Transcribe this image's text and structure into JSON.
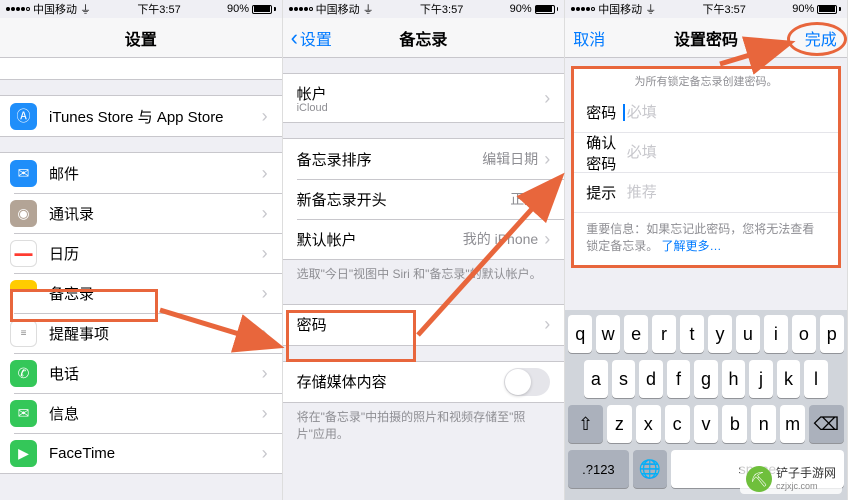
{
  "status": {
    "carrier": "中国移动",
    "time": "下午3:57",
    "battery": "90%"
  },
  "screen1": {
    "title": "设置",
    "itunes": "iTunes Store 与 App Store",
    "items": [
      {
        "label": "邮件",
        "icon_color": "#1f8efa"
      },
      {
        "label": "通讯录",
        "icon_color": "#8e8e93"
      },
      {
        "label": "日历",
        "icon_color": "#ff3b30"
      },
      {
        "label": "备忘录",
        "icon_color": "#ffcc00"
      },
      {
        "label": "提醒事项",
        "icon_color": "#ffffff"
      },
      {
        "label": "电话",
        "icon_color": "#34c759"
      },
      {
        "label": "信息",
        "icon_color": "#34c759"
      },
      {
        "label": "FaceTime",
        "icon_color": "#34c759"
      }
    ]
  },
  "screen2": {
    "back": "设置",
    "title": "备忘录",
    "account_label": "帐户",
    "account_sub": "iCloud",
    "sort_label": "备忘录排序",
    "sort_value": "编辑日期",
    "newstart_label": "新备忘录开头",
    "newstart_value": "正文",
    "default_label": "默认帐户",
    "default_value": "我的 iPhone",
    "default_footer": "选取\"今日\"视图中 Siri 和\"备忘录\"的默认帐户。",
    "password_label": "密码",
    "media_label": "存储媒体内容",
    "media_footer": "将在\"备忘录\"中拍摄的照片和视频存储至\"照片\"应用。"
  },
  "screen3": {
    "cancel": "取消",
    "title": "设置密码",
    "done": "完成",
    "header_hint": "为所有锁定备忘录创建密码。",
    "pwd_label": "密码",
    "pwd_placeholder": "必填",
    "confirm_label": "确认密码",
    "confirm_placeholder": "必填",
    "hint_label": "提示",
    "hint_placeholder": "推荐",
    "footer": "重要信息：如果忘记此密码，您将无法查看锁定备忘录。",
    "footer_link": "了解更多…"
  },
  "keyboard": {
    "row1": [
      "q",
      "w",
      "e",
      "r",
      "t",
      "y",
      "u",
      "i",
      "o",
      "p"
    ],
    "row2": [
      "a",
      "s",
      "d",
      "f",
      "g",
      "h",
      "j",
      "k",
      "l"
    ],
    "row3": [
      "z",
      "x",
      "c",
      "v",
      "b",
      "n",
      "m"
    ],
    "shift": "⇧",
    "backspace": "⌫",
    "numkey": ".?123",
    "space": "space"
  },
  "watermark": {
    "name": "铲子手游网",
    "url": "czjxjc.com"
  },
  "colors": {
    "highlight": "#e8663c",
    "ios_blue": "#007aff"
  }
}
